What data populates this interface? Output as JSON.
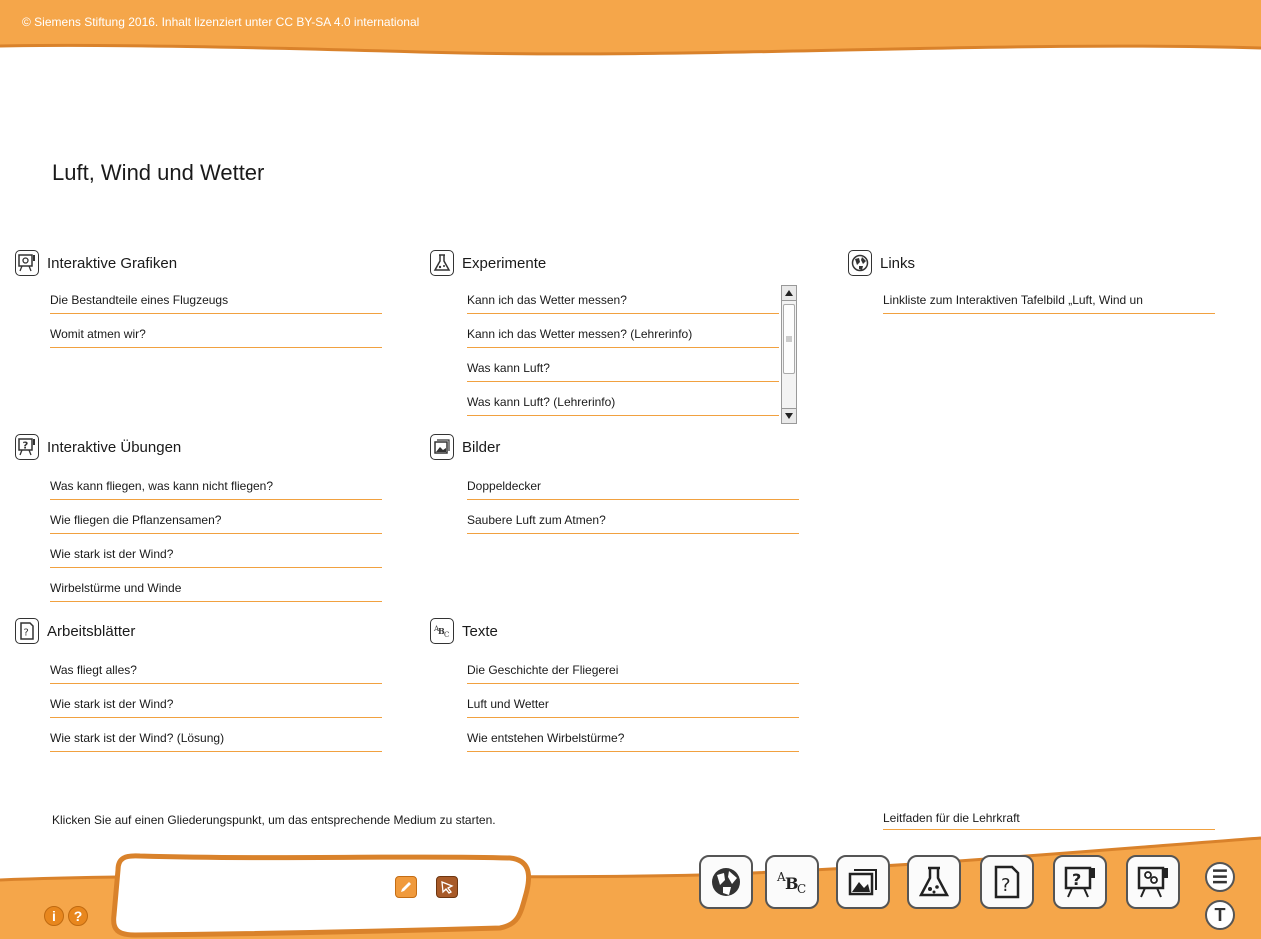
{
  "header": {
    "copyright": "© Siemens Stiftung 2016. Inhalt lizenziert unter CC BY-SA 4.0 international"
  },
  "page_title": "Luft, Wind und Wetter",
  "sections": {
    "interaktive_grafiken": {
      "title": "Interaktive Grafiken",
      "icon": "interactive-graphic-icon",
      "items": [
        "Die Bestandteile eines Flugzeugs",
        "Womit atmen wir?"
      ]
    },
    "experimente": {
      "title": "Experimente",
      "icon": "flask-icon",
      "items": [
        "Kann ich das Wetter messen?",
        "Kann ich das Wetter messen? (Lehrerinfo)",
        "Was kann Luft?",
        "Was kann Luft? (Lehrerinfo)"
      ]
    },
    "links": {
      "title": "Links",
      "icon": "globe-icon",
      "items": [
        "Linkliste zum Interaktiven Tafelbild „Luft, Wind un"
      ]
    },
    "interaktive_uebungen": {
      "title": "Interaktive Übungen",
      "icon": "interactive-exercise-icon",
      "items": [
        "Was kann fliegen, was kann nicht fliegen?",
        "Wie fliegen die Pflanzensamen?",
        "Wie stark ist der Wind?",
        "Wirbelstürme und Winde"
      ]
    },
    "bilder": {
      "title": "Bilder",
      "icon": "image-icon",
      "items": [
        "Doppeldecker",
        "Saubere Luft zum Atmen?"
      ]
    },
    "arbeitsblaetter": {
      "title": "Arbeitsblätter",
      "icon": "worksheet-icon",
      "items": [
        "Was fliegt alles?",
        "Wie stark ist der Wind?",
        "Wie stark ist der Wind? (Lösung)"
      ]
    },
    "texte": {
      "title": "Texte",
      "icon": "text-abc-icon",
      "items": [
        "Die Geschichte der Fliegerei",
        "Luft und Wetter",
        "Wie entstehen Wirbelstürme?"
      ]
    }
  },
  "footer": {
    "hint": "Klicken Sie auf einen Gliederungspunkt, um das entsprechende Medium zu starten.",
    "guide_link": "Leitfaden für die Lehrkraft",
    "round_buttons": {
      "menu": "☰",
      "text": "T"
    },
    "info_buttons": {
      "info": "i",
      "help": "?"
    }
  },
  "colors": {
    "accent": "#f1a140",
    "banner": "#f5a64a",
    "dark_orange": "#d9822b"
  }
}
